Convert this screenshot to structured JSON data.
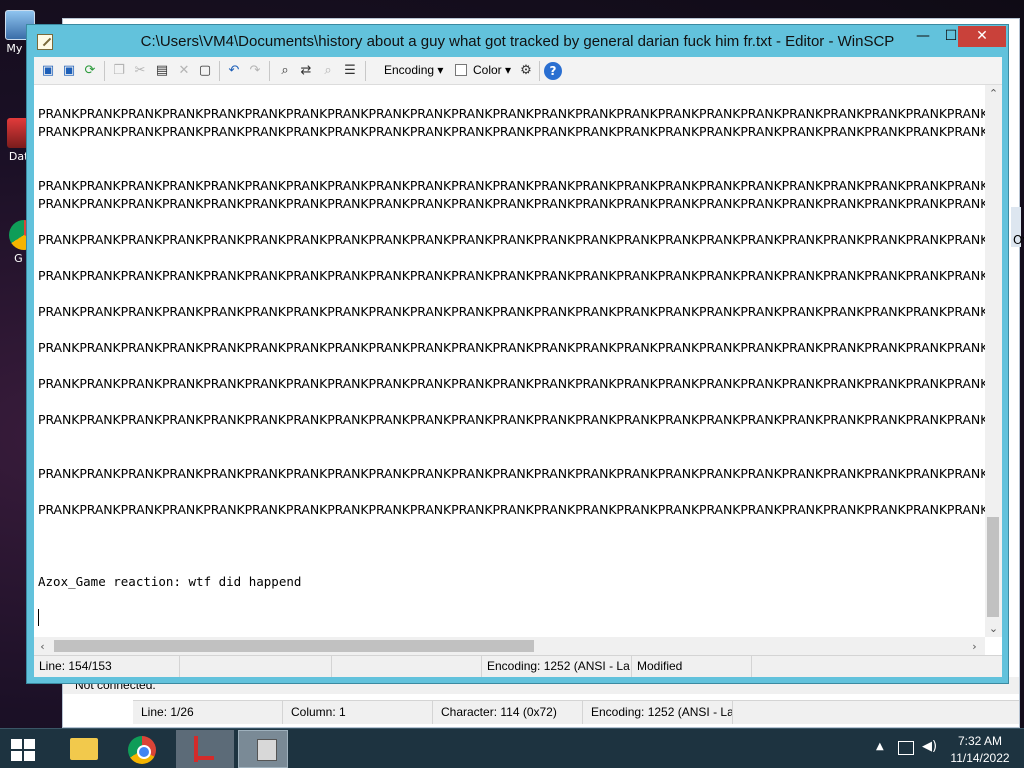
{
  "desktop": {
    "icons": [
      {
        "label": "My C"
      },
      {
        "label": "Data"
      },
      {
        "label": "G C"
      }
    ]
  },
  "background_window": {
    "connection_status": "Not connected.",
    "right_text": "Ov",
    "statusbar": [
      "Line: 1/26",
      "Column: 1",
      "Character: 114 (0x72)",
      "Encoding: 1252  (ANSI - La"
    ]
  },
  "editor": {
    "title": "C:\\Users\\VM4\\Documents\\history about a guy what got tracked by general darian fuck him fr.txt - Editor - WinSCP",
    "window_buttons": {
      "minimize": "—",
      "maximize": "☐",
      "close": "✕"
    },
    "toolbar": {
      "icons": [
        "save-icon",
        "save-all-icon",
        "reload-icon",
        "copy-icon",
        "cut-icon",
        "paste-icon",
        "delete-icon",
        "select-all-icon",
        "undo-icon",
        "redo-icon",
        "find-icon",
        "replace-icon",
        "find-next-icon",
        "goto-line-icon",
        "preferences-icon",
        "help-icon"
      ],
      "encoding_label": "Encoding ▾",
      "color_label": "Color ▾",
      "help_glyph": "?"
    },
    "lines": [
      "PRANKPRANKPRANKPRANKPRANKPRANKPRANKPRANKPRANKPRANKPRANKPRANKPRANKPRANKPRANKPRANKPRANKPRANKPRANKPRANKPRANKPRANKPRANKPRANKPRANKPRA",
      "PRANKPRANKPRANKPRANKPRANKPRANKPRANKPRANKPRANKPRANKPRANKPRANKPRANKPRANKPRANKPRANKPRANKPRANKPRANKPRANKPRANKPRANKPRANKPRANKPRANKPRA",
      "",
      "",
      "PRANKPRANKPRANKPRANKPRANKPRANKPRANKPRANKPRANKPRANKPRANKPRANKPRANKPRANKPRANKPRANKPRANKPRANKPRANKPRANKPRANKPRANKPRANKPRANKPRANKPRA",
      "PRANKPRANKPRANKPRANKPRANKPRANKPRANKPRANKPRANKPRANKPRANKPRANKPRANKPRANKPRANKPRANKPRANKPRANKPRANKPRANKPRANKPRANKPRANKPRANKPRANKPRA",
      "",
      "PRANKPRANKPRANKPRANKPRANKPRANKPRANKPRANKPRANKPRANKPRANKPRANKPRANKPRANKPRANKPRANKPRANKPRANKPRANKPRANKPRANKPRANKPRANKPRANKPRANKPRA",
      "",
      "PRANKPRANKPRANKPRANKPRANKPRANKPRANKPRANKPRANKPRANKPRANKPRANKPRANKPRANKPRANKPRANKPRANKPRANKPRANKPRANKPRANKPRANKPRANKPRANKPRANKPRA",
      "",
      "PRANKPRANKPRANKPRANKPRANKPRANKPRANKPRANKPRANKPRANKPRANKPRANKPRANKPRANKPRANKPRANKPRANKPRANKPRANKPRANKPRANKPRANKPRANKPRANKPRANKPRA",
      "",
      "PRANKPRANKPRANKPRANKPRANKPRANKPRANKPRANKPRANKPRANKPRANKPRANKPRANKPRANKPRANKPRANKPRANKPRANKPRANKPRANKPRANKPRANKPRANKPRANKPRANKPRA",
      "",
      "PRANKPRANKPRANKPRANKPRANKPRANKPRANKPRANKPRANKPRANKPRANKPRANKPRANKPRANKPRANKPRANKPRANKPRANKPRANKPRANKPRANKPRANKPRANKPRANKPRANKPRA",
      "",
      "PRANKPRANKPRANKPRANKPRANKPRANKPRANKPRANKPRANKPRANKPRANKPRANKPRANKPRANKPRANKPRANKPRANKPRANKPRANKPRANKPRANKPRANKPRANKPRANKPRANKPRA",
      "",
      "",
      "PRANKPRANKPRANKPRANKPRANKPRANKPRANKPRANKPRANKPRANKPRANKPRANKPRANKPRANKPRANKPRANKPRANKPRANKPRANKPRANKPRANKPRANKPRANKPRANKPRANKPRA",
      "",
      "PRANKPRANKPRANKPRANKPRANKPRANKPRANKPRANKPRANKPRANKPRANKPRANKPRANKPRANKPRANKPRANKPRANKPRANKPRANKPRANKPRANKPRANKPRANKPRANKPRANKPRA",
      "",
      "",
      "",
      "Azox_Game reaction: wtf did happend"
    ],
    "statusbar": {
      "line": "Line: 154/153",
      "encoding": "Encoding: 1252  (ANSI - La",
      "modified": "Modified"
    }
  },
  "taskbar": {
    "clock_time": "7:32 AM",
    "clock_date": "11/14/2022"
  }
}
